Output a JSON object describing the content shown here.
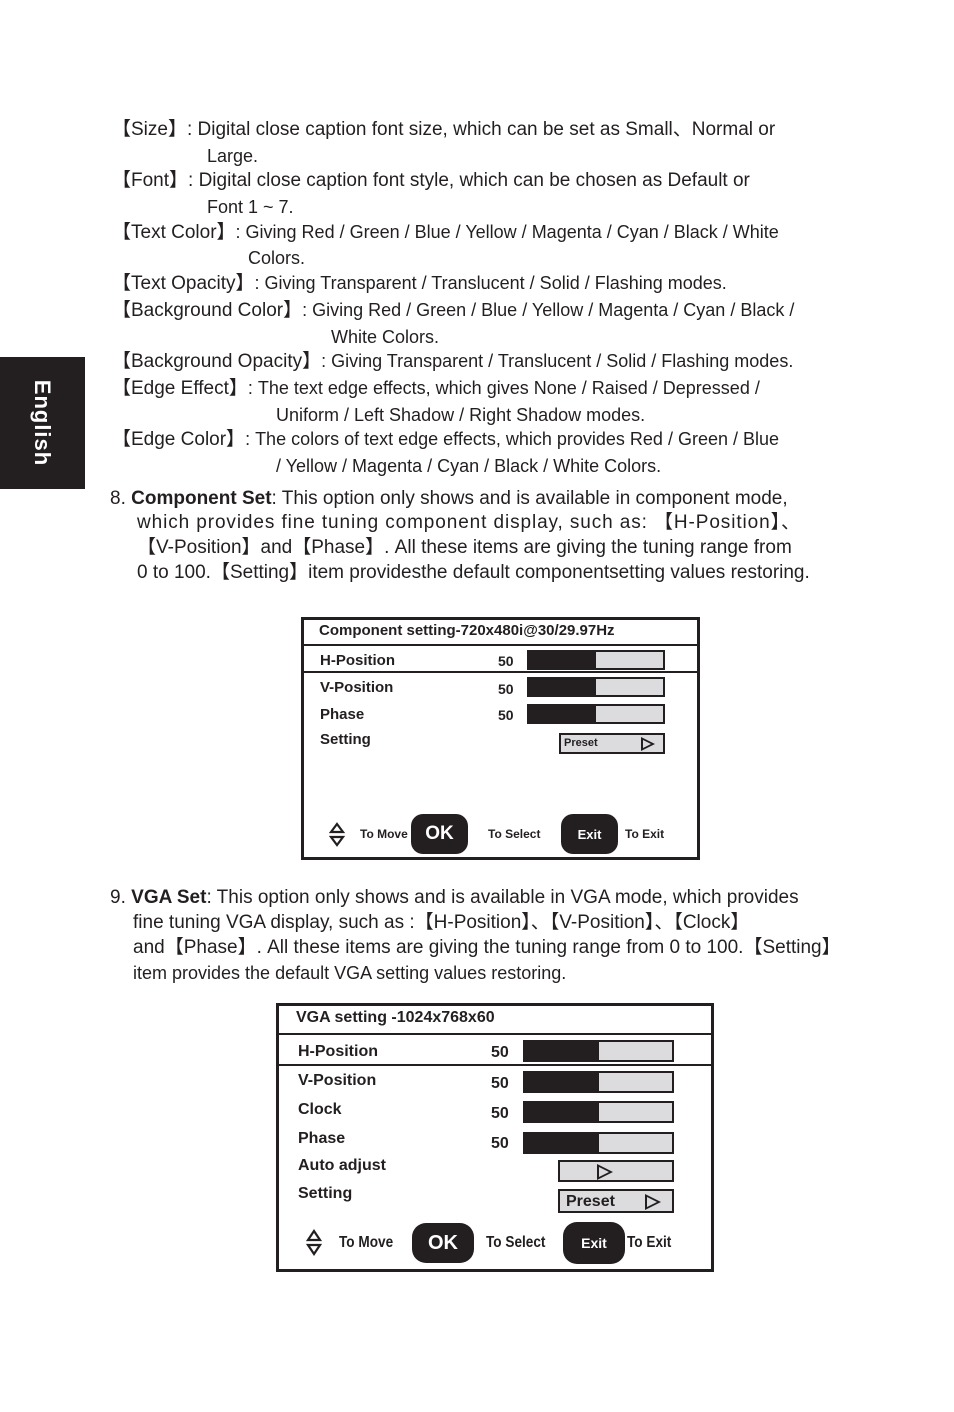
{
  "side_tab": {
    "label": "English"
  },
  "caption_options": [
    {
      "key": "【Size】",
      "text": ": Digital close caption font size, which can be set as Small、Normal  or",
      "cont": "Large."
    },
    {
      "key": "【Font】",
      "text": ": Digital close caption font style, which can be chosen as Default or",
      "cont": "Font 1 ~ 7."
    },
    {
      "key": "【Text Color】",
      "text": ": Giving Red / Green / Blue / Yellow / Magenta / Cyan / Black / White",
      "cont": "Colors."
    },
    {
      "key": "【Text Opacity】",
      "text": ": Giving Transparent / Translucent / Solid / Flashing modes."
    },
    {
      "key": "【Background Color】",
      "text": ": Giving Red / Green / Blue / Yellow / Magenta / Cyan / Black /",
      "cont": "White Colors."
    },
    {
      "key": "【Background Opacity】",
      "text": ": Giving Transparent / Translucent / Solid / Flashing modes."
    },
    {
      "key": "【Edge Effect】",
      "text": ": The text edge effects, which gives None / Raised / Depressed  /",
      "cont": "Uniform / Left Shadow / Right Shadow modes."
    },
    {
      "key": "【Edge Color】",
      "text": ": The colors of text edge effects, which provides Red / Green / Blue",
      "cont": "/ Yellow / Magenta / Cyan / Black / White Colors."
    }
  ],
  "section8": {
    "number": "8.",
    "title": "Component Set",
    "lines": [
      ": This option only shows and is available in component  mode,",
      "which provides fine tuning component display, such as: 【H-Position】、",
      "【V-Position】and【Phase】. All these items are giving the tuning range from",
      "0 to 100.【Setting】item providesthe default componentsetting values restoring."
    ]
  },
  "component_osd": {
    "title": "Component setting-720x480i@30/29.97Hz",
    "rows": [
      {
        "label": "H-Position",
        "value": "50",
        "level": 0.5
      },
      {
        "label": "V-Position",
        "value": "50",
        "level": 0.5
      },
      {
        "label": "Phase",
        "value": "50",
        "level": 0.5
      }
    ],
    "setting": {
      "label": "Setting",
      "button": "Preset"
    },
    "footer": {
      "move": "To Move",
      "ok": "OK",
      "select": "To Select",
      "exit": "Exit",
      "exit_hint": "To Exit"
    }
  },
  "section9": {
    "number": "9.",
    "title": "VGA Set",
    "lines": [
      ": This option only shows and is available in VGA mode, which provides",
      "fine tuning VGA display, such as :【H-Position】、【V-Position】、【Clock】",
      "and【Phase】. All these items  are giving the tuning range from 0 to 100.【Setting】",
      "item provides the default VGA setting values restoring."
    ]
  },
  "vga_osd": {
    "title": "VGA setting -1024x768x60",
    "rows": [
      {
        "label": "H-Position",
        "value": "50",
        "level": 0.5
      },
      {
        "label": "V-Position",
        "value": "50",
        "level": 0.5
      },
      {
        "label": "Clock",
        "value": "50",
        "level": 0.5
      },
      {
        "label": "Phase",
        "value": "50",
        "level": 0.5
      }
    ],
    "auto_adjust": {
      "label": "Auto adjust"
    },
    "setting": {
      "label": "Setting",
      "button": "Preset"
    },
    "footer": {
      "move": "To Move",
      "ok": "OK",
      "select": "To Select",
      "exit": "Exit",
      "exit_hint": "To Exit"
    }
  }
}
